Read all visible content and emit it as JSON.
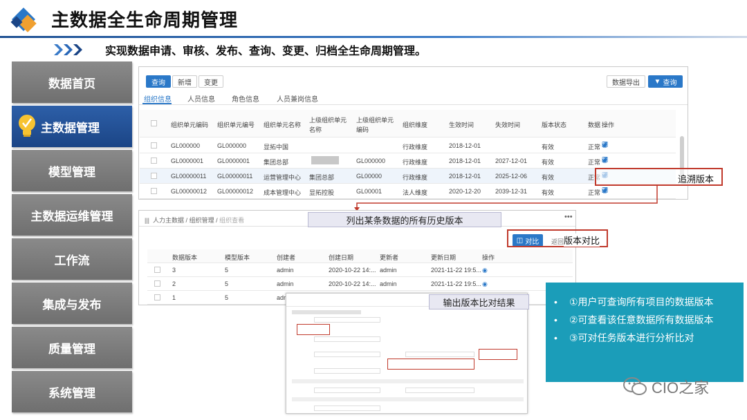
{
  "header": {
    "title": "主数据全生命周期管理",
    "subtitle": "实现数据申请、审核、发布、查询、变更、归档全生命周期管理。"
  },
  "sidebar": {
    "items": [
      {
        "label": "数据首页",
        "active": false
      },
      {
        "label": "主数据管理",
        "active": true
      },
      {
        "label": "模型管理",
        "active": false
      },
      {
        "label": "主数据运维管理",
        "active": false
      },
      {
        "label": "工作流",
        "active": false
      },
      {
        "label": "集成与发布",
        "active": false
      },
      {
        "label": "质量管理",
        "active": false
      },
      {
        "label": "系统管理",
        "active": false
      }
    ]
  },
  "org_panel": {
    "toolbar": {
      "query": "查询",
      "add": "新增",
      "change": "变更",
      "export": "数据导出",
      "search": "查询"
    },
    "tabs": [
      "组织信息",
      "人员信息",
      "角色信息",
      "人员兼岗信息"
    ],
    "columns": [
      "组织单元编码",
      "组织单元编号",
      "组织单元名称",
      "上级组织单元名称",
      "上级组织单元编码",
      "组织维度",
      "生效时间",
      "失效时间",
      "版本状态",
      "数据",
      "操作"
    ],
    "rows": [
      [
        "GL000000",
        "GL000000",
        "显拓中国",
        "",
        "",
        "行政维度",
        "2018-12-01",
        "",
        "有效",
        "正常"
      ],
      [
        "GL0000001",
        "GL0000001",
        "集团总部",
        "",
        "GL000000",
        "行政维度",
        "2018-12-01",
        "2027-12-01",
        "有效",
        "正常"
      ],
      [
        "GL00000011",
        "GL00000011",
        "运营管理中心",
        "集团总部",
        "GL00000",
        "行政维度",
        "2018-12-01",
        "2025-12-06",
        "有效",
        "正常"
      ],
      [
        "GL00000012",
        "GL00000012",
        "成本管理中心",
        "显拓控股",
        "GL00001",
        "法人维度",
        "2020-12-20",
        "2039-12-31",
        "有效",
        "正常"
      ]
    ]
  },
  "history_panel": {
    "breadcrumb": [
      "人力主数据",
      "组织管理",
      "组织查看"
    ],
    "compare_button": "对比",
    "back_button": "返回",
    "columns": [
      "数据版本",
      "模型版本",
      "创建者",
      "创建日期",
      "更新者",
      "更新日期",
      "操作"
    ],
    "rows": [
      [
        "3",
        "5",
        "admin",
        "2020-10-22 14:...",
        "admin",
        "2021-11-22 19:5..."
      ],
      [
        "2",
        "5",
        "admin",
        "2020-10-22 14:...",
        "admin",
        "2021-11-22 19:5..."
      ],
      [
        "1",
        "5",
        "admin",
        "2020-10-22 14:...",
        "",
        ""
      ]
    ]
  },
  "callouts": {
    "trace": "追溯版本",
    "list_history": "列出某条数据的所有历史版本",
    "compare": "版本对比",
    "output": "输出版本比对结果"
  },
  "info_box": {
    "bullets": [
      "①用户可查询所有项目的数据版本",
      "②可查看该任意数据所有数据版本",
      "③可对任务版本进行分析比对"
    ]
  },
  "watermark": "CIO之家",
  "colors": {
    "brand_blue": "#1b4586",
    "accent_blue": "#2a78c8",
    "teal": "#1b9db9",
    "red": "#c0392b",
    "sidebar_gray": "#7a7a7a"
  }
}
